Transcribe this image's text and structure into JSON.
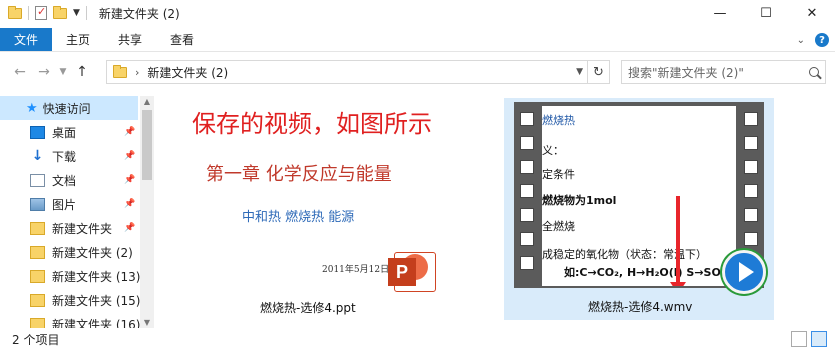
{
  "window": {
    "title": "新建文件夹 (2)",
    "minimize": "—",
    "maximize": "☐",
    "close": "✕"
  },
  "ribbon": {
    "tabs": [
      "文件",
      "主页",
      "共享",
      "查看"
    ]
  },
  "navigation": {
    "back": "←",
    "forward": "→",
    "up": "↑",
    "path": "新建文件夹 (2)",
    "search_placeholder": "搜索\"新建文件夹 (2)\""
  },
  "sidebar": {
    "quick_access": "快速访问",
    "items": [
      {
        "label": "桌面",
        "icon": "desktop-icon",
        "pinned": true
      },
      {
        "label": "下载",
        "icon": "download-icon",
        "pinned": true
      },
      {
        "label": "文档",
        "icon": "documents-icon",
        "pinned": true
      },
      {
        "label": "图片",
        "icon": "pictures-icon",
        "pinned": true
      },
      {
        "label": "新建文件夹",
        "icon": "folder-icon",
        "pinned": true
      },
      {
        "label": "新建文件夹 (2)",
        "icon": "folder-icon",
        "pinned": false
      },
      {
        "label": "新建文件夹 (13)",
        "icon": "folder-icon",
        "pinned": false
      },
      {
        "label": "新建文件夹 (15)",
        "icon": "folder-icon",
        "pinned": false
      },
      {
        "label": "新建文件夹 (16)",
        "icon": "folder-icon",
        "pinned": false
      }
    ]
  },
  "files": [
    {
      "name": "燃烧热-选修4.ppt",
      "thumbnail": {
        "title": "保存的视频，如图所示",
        "subtitle": "第一章  化学反应与能量",
        "terms": "中和热   燃烧热  能源",
        "date": "2011年5月12日"
      }
    },
    {
      "name": "燃烧热-选修4.wmv",
      "thumbnail": {
        "lines": [
          "燃烧热",
          "义：",
          "定条件",
          "燃烧物为1mol",
          "全燃烧",
          "成稳定的氧化物（状态：常温下）",
          "如:C→CO₂, H→H₂O(l)  S→SO₂"
        ]
      }
    }
  ],
  "status": {
    "count": "2 个项目"
  },
  "colors": {
    "accent": "#1979ca",
    "selected_bg": "#cce8ff",
    "slide_red": "#e02020"
  }
}
